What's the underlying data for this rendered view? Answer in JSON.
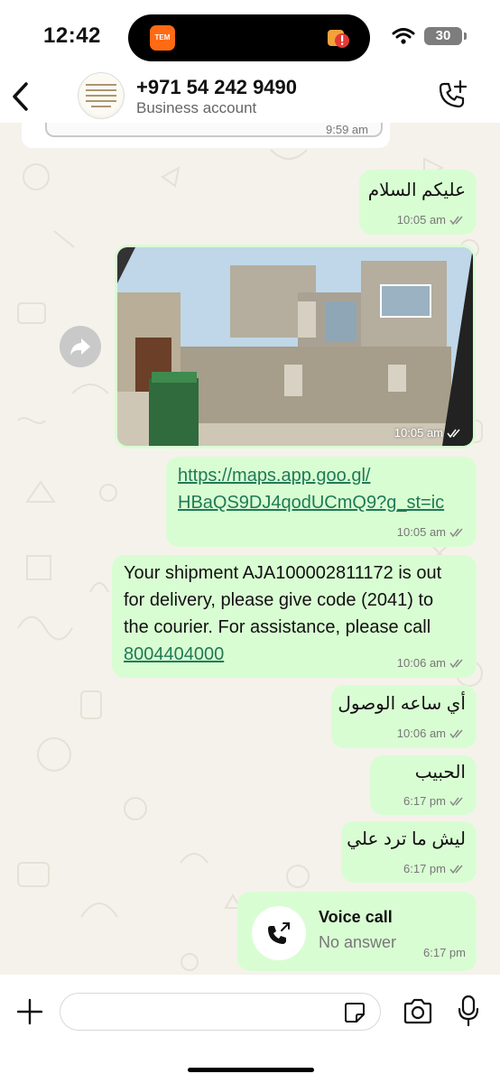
{
  "status": {
    "time": "12:42",
    "island_app": "TEM",
    "battery": "30"
  },
  "header": {
    "contact": "+971 54 242 9490",
    "subtitle": "Business account",
    "back_icon": "chevron-left-icon",
    "call_icon": "phone-add-icon"
  },
  "messages": [
    {
      "type": "incoming-clipped",
      "time": "9:59 am"
    },
    {
      "type": "text",
      "text": "عليكم السلام",
      "time": "10:05 am",
      "status": "delivered"
    },
    {
      "type": "image",
      "caption": "",
      "time": "10:05 am",
      "status": "delivered"
    },
    {
      "type": "link",
      "line1": "https://maps.app.goo.gl/",
      "line2": "HBaQS9DJ4qodUCmQ9?g_st=ic",
      "time": "10:05 am",
      "status": "delivered"
    },
    {
      "type": "text",
      "line1": "Your shipment AJA100002811172 is out",
      "line2": "for delivery, please give code (2041) to",
      "line3": "the courier. For assistance, please call",
      "phone": "8004404000",
      "time": "10:06 am",
      "status": "delivered"
    },
    {
      "type": "text",
      "text": "أي ساعه الوصول",
      "time": "10:06 am",
      "status": "delivered"
    },
    {
      "type": "text",
      "text": "الحبيب",
      "time": "6:17 pm",
      "status": "delivered"
    },
    {
      "type": "text",
      "text": "ليش ما ترد علي",
      "time": "6:17 pm",
      "status": "delivered"
    },
    {
      "type": "call",
      "title": "Voice call",
      "subtitle": "No answer",
      "time": "6:17 pm"
    }
  ],
  "colors": {
    "outgoing_bubble": "#d9fdd3",
    "chat_background": "#f5f2ec",
    "link": "#1f7a56",
    "tick": "#8a8a8a"
  },
  "input": {
    "placeholder": ""
  }
}
